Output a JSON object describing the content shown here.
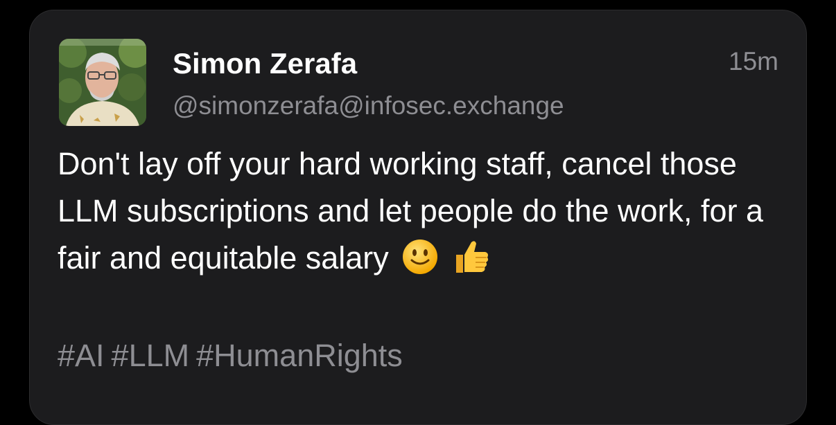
{
  "post": {
    "author": {
      "display_name": "Simon Zerafa",
      "handle": "@simonzerafa@infosec.exchange",
      "avatar_icon": "profile-photo"
    },
    "timestamp": "15m",
    "text": "Don't lay off your hard working staff, cancel those LLM subscriptions and let people do the work, for a fair and equitable salary",
    "emojis": [
      "slightly-smiling-face-icon",
      "thumbs-up-icon"
    ],
    "hashtags": [
      "#AI",
      "#LLM",
      "#HumanRights"
    ]
  },
  "colors": {
    "background": "#000000",
    "card": "#1c1c1e",
    "primary_text": "#ffffff",
    "secondary_text": "#8e8e93",
    "emoji_yellow": "#ffcc33"
  }
}
